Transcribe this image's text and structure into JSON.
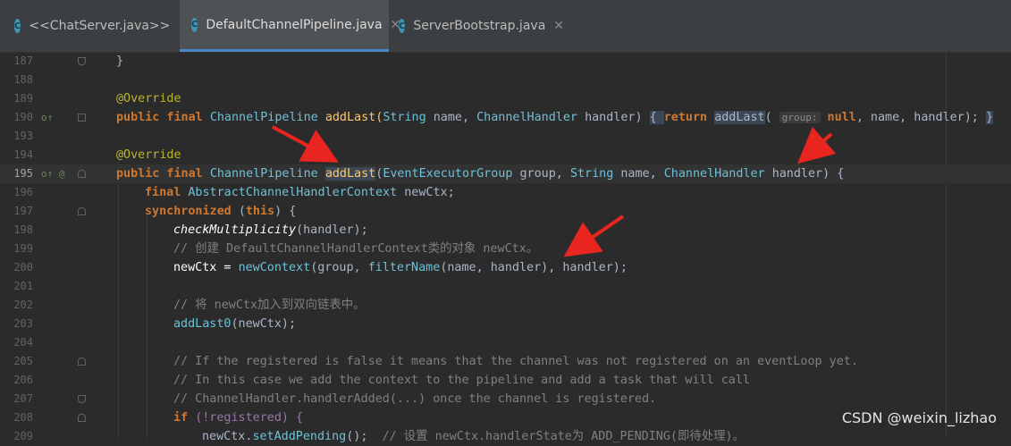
{
  "tabs": [
    {
      "label": "<<ChatServer.java>>",
      "icon": "c-class-icon",
      "close": "✕"
    },
    {
      "label": "DefaultChannelPipeline.java",
      "icon": "c-class-icon",
      "close": "✕"
    },
    {
      "label": "ServerBootstrap.java",
      "icon": "c-class-icon",
      "close": "✕"
    }
  ],
  "lines": [
    {
      "n": "187"
    },
    {
      "n": "188"
    },
    {
      "n": "189"
    },
    {
      "n": "190"
    },
    {
      "n": "193"
    },
    {
      "n": "194"
    },
    {
      "n": "195"
    },
    {
      "n": "196"
    },
    {
      "n": "197"
    },
    {
      "n": "198"
    },
    {
      "n": "199"
    },
    {
      "n": "200"
    },
    {
      "n": "201"
    },
    {
      "n": "202"
    },
    {
      "n": "203"
    },
    {
      "n": "204"
    },
    {
      "n": "205"
    },
    {
      "n": "206"
    },
    {
      "n": "207"
    },
    {
      "n": "208"
    },
    {
      "n": "209"
    }
  ],
  "code": {
    "l187": "}",
    "l189": "@Override",
    "l190_a": "public final ",
    "l190_b": "ChannelPipeline ",
    "l190_c": "addLast(",
    "l190_d": "String ",
    "l190_e": "name, ",
    "l190_f": "ChannelHandler ",
    "l190_g": "handler) ",
    "l190_h": "{ ",
    "l190_i": "return ",
    "l190_j": "addLast",
    "l190_k": "( ",
    "l190_hint": "group:",
    "l190_l": " null",
    "l190_m": ", name, handler); ",
    "l190_n": "}",
    "l194": "@Override",
    "l195_a": "public final ",
    "l195_b": "ChannelPipeline ",
    "l195_c": "addLast",
    "l195_d": "(",
    "l195_e": "EventExecutorGroup ",
    "l195_f": "group, ",
    "l195_g": "String ",
    "l195_h": "name, ",
    "l195_i": "ChannelHandler ",
    "l195_j": "handler) {",
    "l196_a": "final ",
    "l196_b": "AbstractChannelHandlerContext ",
    "l196_c": "newCtx;",
    "l197_a": "synchronized ",
    "l197_b": "(",
    "l197_c": "this",
    "l197_d": ") {",
    "l198_a": "checkMultiplicity",
    "l198_b": "(handler);",
    "l199": "// 创建 DefaultChannelHandlerContext类的对象 newCtx。",
    "l200_a": "newCtx = ",
    "l200_b": "newContext",
    "l200_c": "(group, ",
    "l200_d": "filterName",
    "l200_e": "(name, handler), handler);",
    "l202": "// 将 newCtx加入到双向链表中。",
    "l203_a": "addLast0",
    "l203_b": "(newCtx);",
    "l205": "// If the registered is false it means that the channel was not registered on an eventLoop yet.",
    "l206": "// In this case we add the context to the pipeline and add a task that will call",
    "l207": "// ChannelHandler.handlerAdded(...) once the channel is registered.",
    "l208_a": "if ",
    "l208_b": "(!registered) {",
    "l209_a": "newCtx.",
    "l209_b": "setAddPending",
    "l209_c": "();  ",
    "l209_d": "// 设置 newCtx.handlerState为 ADD_PENDING(即待处理)。"
  },
  "gutter": {
    "l190_icons": "o↑",
    "l195_icons": "o↑ @"
  },
  "watermark": "CSDN @weixin_lizhao",
  "colors": {
    "background": "#2b2b2b",
    "keyword": "#cc7832",
    "annotation": "#bbb529",
    "comment": "#808080",
    "method": "#ffc66d",
    "arrow": "#e8251e"
  }
}
